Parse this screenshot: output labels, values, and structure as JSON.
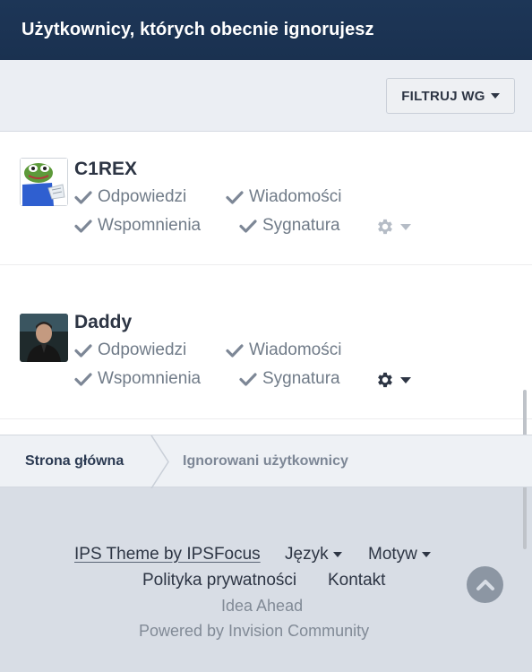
{
  "header": {
    "title": "Użytkownicy, których obecnie ignorujesz"
  },
  "filter": {
    "label": "FILTRUJ WG"
  },
  "users": [
    {
      "name": "C1REX",
      "options": {
        "replies": "Odpowiedzi",
        "messages": "Wiadomości",
        "mentions": "Wspomnienia",
        "signature": "Sygnatura"
      },
      "options_state": "checked"
    },
    {
      "name": "Daddy",
      "options": {
        "replies": "Odpowiedzi",
        "messages": "Wiadomości",
        "mentions": "Wspomnienia",
        "signature": "Sygnatura"
      },
      "options_state": "checked"
    }
  ],
  "breadcrumb": {
    "home": "Strona główna",
    "current": "Ignorowani użytkownicy"
  },
  "footer": {
    "theme_link": "IPS Theme by IPSFocus",
    "language": "Język",
    "theme": "Motyw",
    "privacy": "Polityka prywatności",
    "contact": "Kontakt",
    "tagline": "Idea Ahead",
    "powered": "Powered by Invision Community"
  },
  "colors": {
    "header_bg": "#1d3657",
    "check": "#7d8796",
    "gear_active": "#2d3544",
    "gear_muted": "#b5bcc6"
  },
  "icons": [
    "check-icon",
    "gear-icon",
    "chevron-down-icon",
    "chevron-up-icon"
  ]
}
